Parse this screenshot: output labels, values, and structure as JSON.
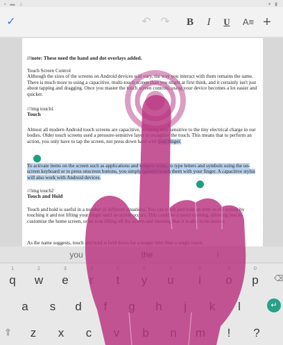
{
  "status_bar": {
    "left_icons": "▪ ▬ ⊥",
    "right_icons": "▾ ▮"
  },
  "toolbar": {
    "check_icon": "check-icon",
    "undo_icon": "undo-icon",
    "redo_icon": "redo-icon",
    "bold_label": "B",
    "italic_label": "I",
    "underline_label": "U",
    "format_label": "A≡",
    "add_label": "+"
  },
  "document": {
    "note": "///note: These need the hand and dot overlays added.",
    "b1_title": "Touch Screen Control",
    "b1_text": "Although the sizes of the screens on Android devices will vary, the way you interact with them remains the same. There is much more to using a capacitive, multi-touch screen than you might at first think, and it certainly isn't just about tapping and dragging. Once you master the touch screen controls, using your device becomes a lot easier and quicker.",
    "b2_img": "///img touch1",
    "b2_heading": "Touch",
    "b3_text_a": "Almost all modern Android touch screens are capacitive, meaning they sensitive to the tiny electrical charge in our bodies. Older touch screens used a pressure-sensitive layer to recognise the touch. This means that to perform an action, you only have to tap the screen, not press down hard with ",
    "b3_text_sel": "your finger.",
    "b4_text": "To activate items on the screen such as applications and widgets icons, to type letters and symbols using the on-screen keyboard or to press onscreen buttons, you simply (gently) touch them with your finger. A capacitive stylus will also work with Android devices.",
    "b5_img": "///img touch2",
    "b5_heading": "Touch and Hold",
    "b6_text": "Touch and hold is useful in a number of different situations. You can touch and hold an item on the screen by touching it and not lifting your finger until an action occurs. This could be a menu opening, allowing you to customise the home screen, or an icon lifting off the screen and showing that it is able to be moved.",
    "b7_text": "As the name suggests, touch and hold is held down for a longer time than a single touch."
  },
  "suggestions": {
    "left": "you",
    "center": "the",
    "right": "I",
    "more": "•••"
  },
  "keyboard": {
    "row1": [
      {
        "k": "q",
        "h": "1"
      },
      {
        "k": "w",
        "h": "2"
      },
      {
        "k": "e",
        "h": "3"
      },
      {
        "k": "r",
        "h": "4"
      },
      {
        "k": "t",
        "h": "5"
      },
      {
        "k": "y",
        "h": "6"
      },
      {
        "k": "u",
        "h": "7"
      },
      {
        "k": "i",
        "h": "8"
      },
      {
        "k": "o",
        "h": "9"
      },
      {
        "k": "p",
        "h": "0"
      }
    ],
    "row2": [
      "a",
      "s",
      "d",
      "f",
      "g",
      "h",
      "j",
      "k",
      "l"
    ],
    "row3": [
      "z",
      "x",
      "c",
      "v",
      "b",
      "n",
      "m",
      "!",
      "?"
    ],
    "shift_label": "⇧",
    "enter_label": "↵",
    "backspace_label": "⌫"
  },
  "colors": {
    "accent": "#3b7bd4",
    "selection": "#b9d3ee",
    "handle": "#1e9e84",
    "hand": "#b8327f"
  }
}
